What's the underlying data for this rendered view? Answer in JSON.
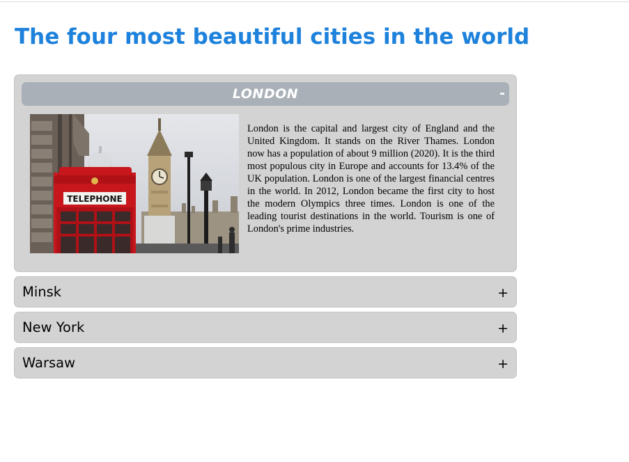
{
  "page": {
    "title": "The four most beautiful cities in the world"
  },
  "colors": {
    "title": "#1e82dc",
    "panel": "#d3d3d3",
    "open_header": "#a9b0b8"
  },
  "accordion": {
    "open_item": {
      "title": "LONDON",
      "toggle": "-",
      "image": "london-telephone-box-big-ben-photo",
      "image_sign": "TELEPHONE",
      "text": "London is the capital and largest city of England and the United Kingdom. It stands on the River Thames. London now has a population of about 9 million (2020). It is the third most populous city in Europe and accounts for 13.4% of the UK population. London is one of the largest financial centres in the world. In 2012, London became the first city to host the modern Olympics three times. London is one of the leading tourist destinations in the world. Tourism is one of London's prime industries."
    },
    "closed_items": [
      {
        "label": "Minsk",
        "toggle": "+"
      },
      {
        "label": "New York",
        "toggle": "+"
      },
      {
        "label": "Warsaw",
        "toggle": "+"
      }
    ]
  }
}
